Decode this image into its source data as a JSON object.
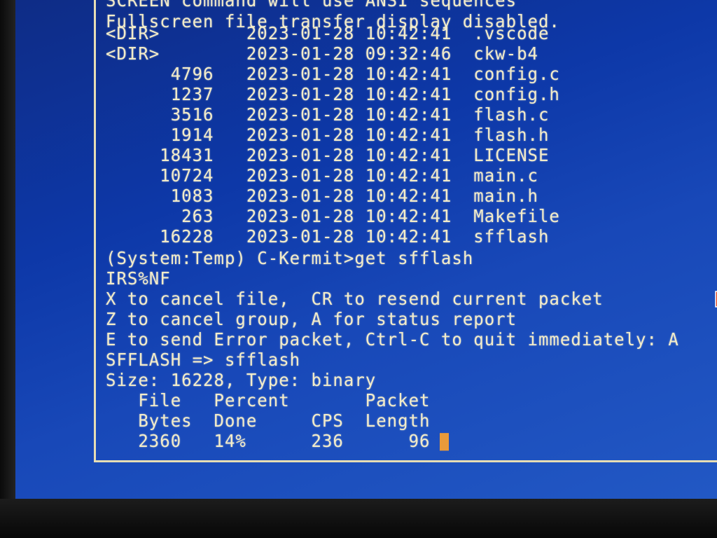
{
  "terminal": {
    "lines": [
      "SCREEN command will use ANSI sequences",
      "Fullscreen file transfer display disabled.",
      "<DIR>        2023-01-28 10:42:41  .vscode",
      "<DIR>        2023-01-28 09:32:46  ckw-b4",
      "      4796   2023-01-28 10:42:41  config.c",
      "      1237   2023-01-28 10:42:41  config.h",
      "      3516   2023-01-28 10:42:41  flash.c",
      "      1914   2023-01-28 10:42:41  flash.h",
      "     18431   2023-01-28 10:42:41  LICENSE",
      "     10724   2023-01-28 10:42:41  main.c",
      "      1083   2023-01-28 10:42:41  main.h",
      "       263   2023-01-28 10:42:41  Makefile",
      "     16228   2023-01-28 10:42:41  sfflash",
      "(System:Temp) C-Kermit>get sfflash",
      "IRS%NF",
      "X to cancel file,  CR to resend current packet",
      "Z to cancel group, A for status report",
      "E to send Error packet, Ctrl-C to quit immediately: A",
      "SFFLASH => sfflash",
      "Size: 16228, Type: binary",
      "   File   Percent       Packet",
      "   Bytes  Done     CPS  Length",
      "   2360   14%      236      96"
    ]
  },
  "icons": {
    "cursor": "block-cursor-icon",
    "pointer": "mouse-pointer-icon"
  },
  "colors": {
    "screen": "#0d38a8",
    "text": "#f3ecc9",
    "cursor": "#e89a3a",
    "pointer": "#e0451e"
  }
}
